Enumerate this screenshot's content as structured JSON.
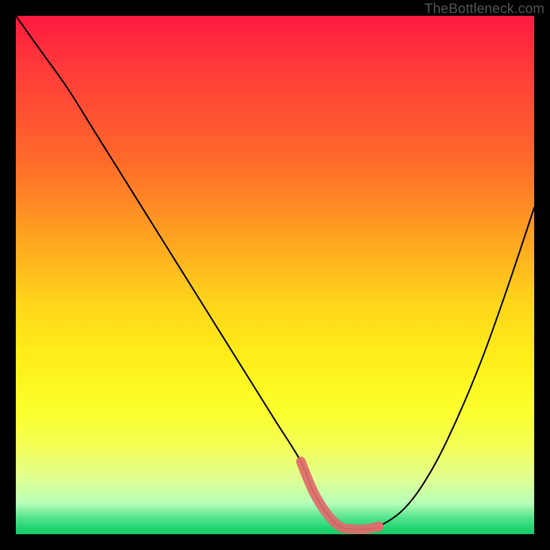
{
  "watermark": {
    "text": "TheBottleneck.com"
  },
  "colors": {
    "gradient_top": "#ff1a3f",
    "gradient_bottom": "#17c968",
    "curve": "#000000",
    "highlight": "#e06b6b",
    "frame": "#000000"
  },
  "chart_data": {
    "type": "line",
    "title": "",
    "xlabel": "",
    "ylabel": "",
    "xlim": [
      0,
      100
    ],
    "ylim": [
      0,
      100
    ],
    "grid": false,
    "legend": false,
    "annotations": [],
    "series": [
      {
        "name": "curve",
        "x": [
          0,
          5,
          10,
          15,
          20,
          25,
          30,
          35,
          40,
          45,
          50,
          55,
          57.5,
          60,
          62.5,
          65,
          67.5,
          70,
          75,
          80,
          85,
          90,
          95,
          100
        ],
        "values": [
          100,
          93,
          86,
          78,
          70,
          62,
          54,
          46,
          38,
          30,
          22,
          14,
          8,
          4,
          1.5,
          1,
          1,
          1.5,
          5,
          12,
          22,
          34,
          48,
          63
        ]
      },
      {
        "name": "highlight-segment",
        "x": [
          55,
          57.5,
          60,
          62.5,
          65,
          67.5,
          70
        ],
        "values": [
          14,
          8,
          4,
          1.5,
          1,
          1,
          1.5
        ]
      }
    ]
  }
}
